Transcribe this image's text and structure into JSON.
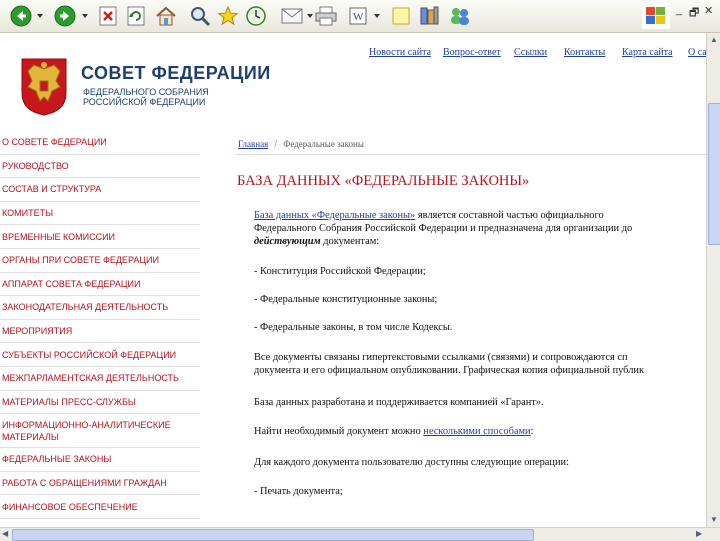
{
  "toolbar": {
    "buttons": [
      "back-icon",
      "forward-icon",
      "stop-icon",
      "refresh-icon",
      "home-icon",
      "search-icon",
      "favorites-icon",
      "history-icon",
      "mail-icon",
      "print-icon",
      "edit-icon",
      "notes-icon",
      "research-icon",
      "messenger-icon"
    ],
    "window_controls": [
      "_",
      "🗗",
      "✕"
    ]
  },
  "nav": {
    "links": [
      "Новости сайта",
      "Вопрос-ответ",
      "Ссылки",
      "Контакты",
      "Карта сайта",
      "О сай"
    ]
  },
  "header": {
    "title": "СОВЕТ ФЕДЕРАЦИИ",
    "subtitle_line1": "ФЕДЕРАЛЬНОГО СОБРАНИЯ",
    "subtitle_line2": "РОССИЙСКОЙ ФЕДЕРАЦИИ"
  },
  "sidebar": {
    "items": [
      "О СОВЕТЕ ФЕДЕРАЦИИ",
      "РУКОВОДСТВО",
      "СОСТАВ И СТРУКТУРА",
      "КОМИТЕТЫ",
      "ВРЕМЕННЫЕ КОМИССИИ",
      "ОРГАНЫ ПРИ СОВЕТЕ ФЕДЕРАЦИИ",
      "АППАРАТ СОВЕТА ФЕДЕРАЦИИ",
      "ЗАКОНОДАТЕЛЬНАЯ ДЕЯТЕЛЬНОСТЬ",
      "МЕРОПРИЯТИЯ",
      "СУБЪЕКТЫ РОССИЙСКОЙ ФЕДЕРАЦИИ",
      "МЕЖПАРЛАМЕНТСКАЯ ДЕЯТЕЛЬНОСТЬ",
      "МАТЕРИАЛЫ ПРЕСС-СЛУЖБЫ",
      "ИНФОРМАЦИОННО-АНАЛИТИЧЕСКИЕ МАТЕРИАЛЫ",
      "ФЕДЕРАЛЬНЫЕ ЗАКОНЫ",
      "РАБОТА С ОБРАЩЕНИЯМИ ГРАЖДАН",
      "ФИНАНСОВОЕ ОБЕСПЕЧЕНИЕ"
    ]
  },
  "breadcrumb": {
    "home": "Главная",
    "separator": "/",
    "current": "Федеральные законы"
  },
  "main": {
    "heading": "БАЗА ДАННЫХ «ФЕДЕРАЛЬНЫЕ ЗАКОНЫ»",
    "p1_link": "База данных «Федеральные законы»",
    "p1_rest": " является составной частью официального",
    "p1_line2": "Федерального Собрания Российской Федерации и предназначена для организации до",
    "p1_line3_em": "действующим",
    "p1_line3_rest": " документам:",
    "li1": "- Конституция Российской Федерации;",
    "li2": "- Федеральные конституционные законы;",
    "li3": "- Федеральные законы, в том числе Кодексы.",
    "p2_line1": "Все документы связаны гипертекстовыми ссылками (связями) и сопровождаются сп",
    "p2_line2": "документа и его официальном опубликовании. Графическая копия официальной публик",
    "p3": "База данных разработана и поддерживается компанией «Гарант».",
    "p4_pre": "Найти необходимый документ можно ",
    "p4_link": "несколькими способами",
    "p4_post": ":",
    "p5": "Для каждого документа пользователю доступны следующие операции:",
    "li4": "- Печать документа;"
  },
  "colors": {
    "accent_red": "#b3121f",
    "link_blue": "#1f3f9f",
    "title_navy": "#1f3f6f"
  }
}
